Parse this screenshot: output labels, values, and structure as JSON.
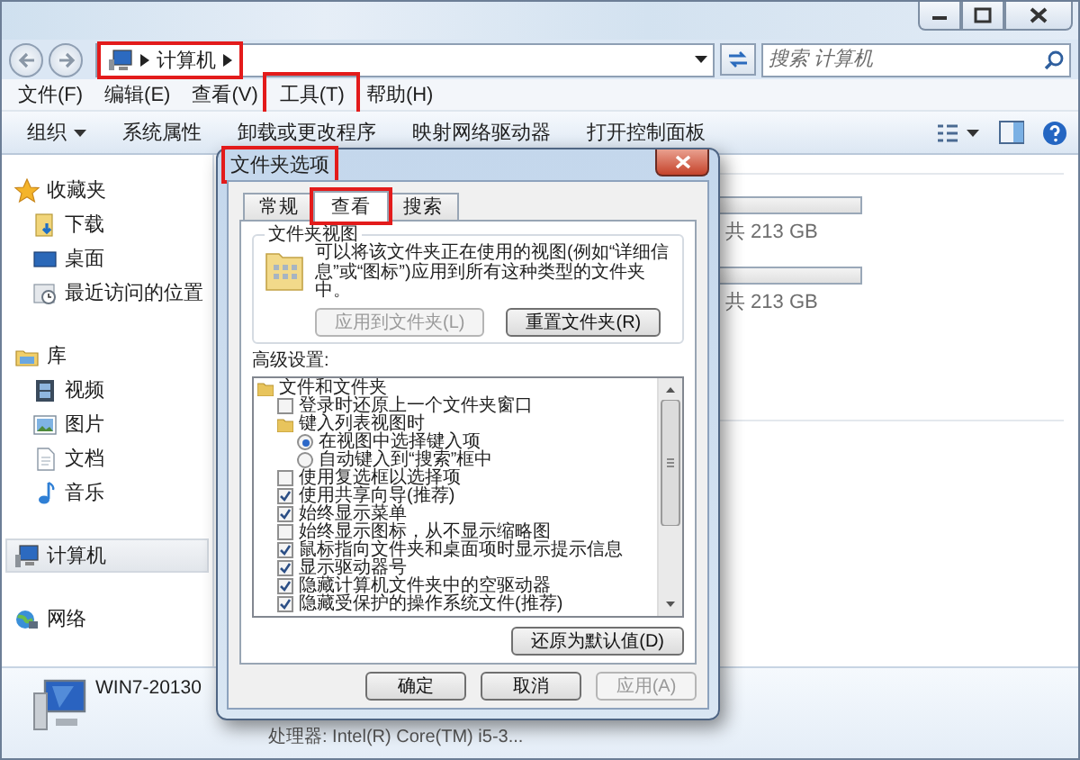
{
  "address_bar": {
    "breadcrumb": {
      "label": "计算机",
      "highlighted": true
    }
  },
  "search": {
    "placeholder": "搜索 计算机"
  },
  "menu": [
    {
      "label": "文件(F)",
      "highlighted": false
    },
    {
      "label": "编辑(E)",
      "highlighted": false
    },
    {
      "label": "查看(V)",
      "highlighted": false
    },
    {
      "label": "工具(T)",
      "highlighted": true
    },
    {
      "label": "帮助(H)",
      "highlighted": false
    }
  ],
  "toolbar": [
    {
      "label": "组织",
      "kind": "menu"
    },
    {
      "label": "系统属性",
      "kind": "button"
    },
    {
      "label": "卸载或更改程序",
      "kind": "button"
    },
    {
      "label": "映射网络驱动器",
      "kind": "button"
    },
    {
      "label": "打开控制面板",
      "kind": "button"
    }
  ],
  "sidebar": {
    "items": [
      {
        "label": "收藏夹",
        "kind": "favorites",
        "selected": false,
        "children": [
          {
            "label": "下载",
            "kind": "downloads",
            "selected": false
          },
          {
            "label": "桌面",
            "kind": "desktop",
            "selected": false
          },
          {
            "label": "最近访问的位置",
            "kind": "recent",
            "selected": false
          }
        ]
      },
      {
        "label": "库",
        "kind": "libraries",
        "selected": false,
        "children": [
          {
            "label": "视频",
            "kind": "videos",
            "selected": false
          },
          {
            "label": "图片",
            "kind": "pictures",
            "selected": false
          },
          {
            "label": "文档",
            "kind": "documents",
            "selected": false
          },
          {
            "label": "音乐",
            "kind": "music",
            "selected": false
          }
        ]
      },
      {
        "label": "计算机",
        "kind": "computer",
        "selected": true
      },
      {
        "label": "网络",
        "kind": "network",
        "selected": false
      }
    ]
  },
  "drives": [
    {
      "size_text": "共 213 GB"
    },
    {
      "size_text": "共 213 GB"
    }
  ],
  "details": {
    "name": "WIN7-20130",
    "processor": "处理器: Intel(R) Core(TM) i5-3..."
  },
  "dialog": {
    "title": "文件夹选项",
    "title_highlighted": true,
    "tabs": [
      {
        "label": "常规",
        "selected": false,
        "highlighted": false
      },
      {
        "label": "查看",
        "selected": true,
        "highlighted": true
      },
      {
        "label": "搜索",
        "selected": false,
        "highlighted": false
      }
    ],
    "folder_views": {
      "title": "文件夹视图",
      "description": "可以将该文件夹正在使用的视图(例如“详细信息”或“图标”)应用到所有这种类型的文件夹中。",
      "buttons": [
        {
          "label": "应用到文件夹(L)",
          "disabled": true
        },
        {
          "label": "重置文件夹(R)",
          "disabled": false
        }
      ]
    },
    "advanced": {
      "title": "高级设置:",
      "items": [
        {
          "kind": "folder",
          "label": "文件和文件夹",
          "children": [
            {
              "kind": "checkbox",
              "label": "登录时还原上一个文件夹窗口",
              "checked": false
            },
            {
              "kind": "folder",
              "label": "键入列表视图时",
              "children": [
                {
                  "kind": "radio",
                  "label": "在视图中选择键入项",
                  "selected": true
                },
                {
                  "kind": "radio",
                  "label": "自动键入到“搜索”框中",
                  "selected": false
                }
              ]
            },
            {
              "kind": "checkbox",
              "label": "使用复选框以选择项",
              "checked": false
            },
            {
              "kind": "checkbox",
              "label": "使用共享向导(推荐)",
              "checked": true
            },
            {
              "kind": "checkbox",
              "label": "始终显示菜单",
              "checked": true
            },
            {
              "kind": "checkbox",
              "label": "始终显示图标，从不显示缩略图",
              "checked": false
            },
            {
              "kind": "checkbox",
              "label": "鼠标指向文件夹和桌面项时显示提示信息",
              "checked": true
            },
            {
              "kind": "checkbox",
              "label": "显示驱动器号",
              "checked": true
            },
            {
              "kind": "checkbox",
              "label": "隐藏计算机文件夹中的空驱动器",
              "checked": true
            },
            {
              "kind": "checkbox",
              "label": "隐藏受保护的操作系统文件(推荐)",
              "checked": true
            }
          ]
        }
      ]
    },
    "restore_button": "还原为默认值(D)",
    "buttons": [
      {
        "label": "确定",
        "disabled": false
      },
      {
        "label": "取消",
        "disabled": false
      },
      {
        "label": "应用(A)",
        "disabled": true
      }
    ]
  }
}
